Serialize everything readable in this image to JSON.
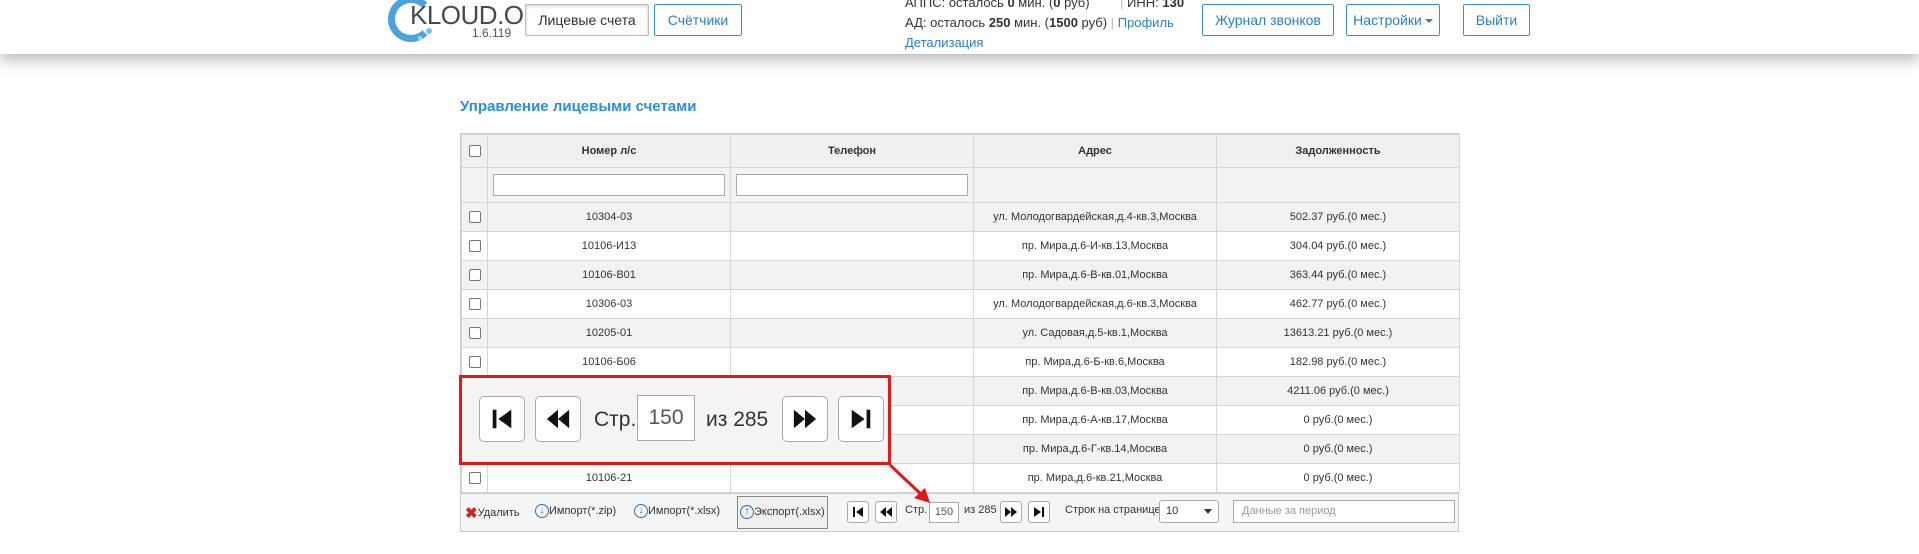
{
  "app": {
    "logo_text": "KLOUD.ONE",
    "version": "1.6.119"
  },
  "header": {
    "tab_accounts": "Лицевые счета",
    "tab_meters": "Счётчики",
    "apps_prefix": "АППС: осталось ",
    "apps_min": "0",
    "apps_mid": " мин. (",
    "apps_rub": "0",
    "apps_suffix": " руб)",
    "inn_label": "ИНН: ",
    "inn_value": "130",
    "ad_prefix": "АД: осталось ",
    "ad_min": "250",
    "ad_mid": " мин. (",
    "ad_rub": "1500",
    "ad_suffix": " руб)",
    "profile_link": "Профиль",
    "details_link": "Детализация",
    "call_log": "Журнал звонков",
    "settings": "Настройки",
    "logout": "Выйти"
  },
  "page": {
    "title": "Управление лицевыми счетами"
  },
  "table": {
    "columns": [
      "Номер л/с",
      "Телефон",
      "Адрес",
      "Задолженность"
    ],
    "rows": [
      {
        "account": "10304-03",
        "phone": "",
        "address": "ул. Молодогвардейская,д.4-кв.3,Москва",
        "debt": "502.37 руб.(0 мес.)"
      },
      {
        "account": "10106-И13",
        "phone": "",
        "address": "пр. Мира,д.6-И-кв.13,Москва",
        "debt": "304.04 руб.(0 мес.)"
      },
      {
        "account": "10106-В01",
        "phone": "",
        "address": "пр. Мира,д.6-В-кв.01,Москва",
        "debt": "363.44 руб.(0 мес.)"
      },
      {
        "account": "10306-03",
        "phone": "",
        "address": "ул. Молодогвардейская,д.6-кв.3,Москва",
        "debt": "462.77 руб.(0 мес.)"
      },
      {
        "account": "10205-01",
        "phone": "",
        "address": "ул. Садовая,д.5-кв.1,Москва",
        "debt": "13613.21 руб.(0 мес.)"
      },
      {
        "account": "10106-Б06",
        "phone": "",
        "address": "пр. Мира,д.6-Б-кв.6,Москва",
        "debt": "182.98 руб.(0 мес.)"
      },
      {
        "account": "",
        "phone": "",
        "address": "пр. Мира,д.6-В-кв.03,Москва",
        "debt": "4211.06 руб.(0 мес.)"
      },
      {
        "account": "",
        "phone": "",
        "address": "пр. Мира,д.6-А-кв.17,Москва",
        "debt": "0 руб.(0 мес.)"
      },
      {
        "account": "",
        "phone": "",
        "address": "пр. Мира,д.6-Г-кв.14,Москва",
        "debt": "0 руб.(0 мес.)"
      },
      {
        "account": "10106-21",
        "phone": "",
        "address": "пр. Мира,д.6-кв.21,Москва",
        "debt": "0 руб.(0 мес.)"
      }
    ]
  },
  "toolbar": {
    "delete": "Удалить",
    "import_zip": "Импорт(*.zip)",
    "import_xlsx": "Импорт(*.xlsx)",
    "export_xlsx": "Экспорт(.xlsx)",
    "page_label": "Стр.",
    "page_value": "150",
    "of_total": "из 285",
    "rows_per_page_label": "Строк на странице:",
    "rows_per_page_value": "10",
    "period_placeholder": "Данные за период"
  },
  "zoom_pager": {
    "page_label": "Стр.",
    "page_value": "150",
    "of_total": "из 285"
  },
  "colors": {
    "accent": "#2a8ed8",
    "highlight": "#e01818",
    "delete": "#d32222"
  }
}
